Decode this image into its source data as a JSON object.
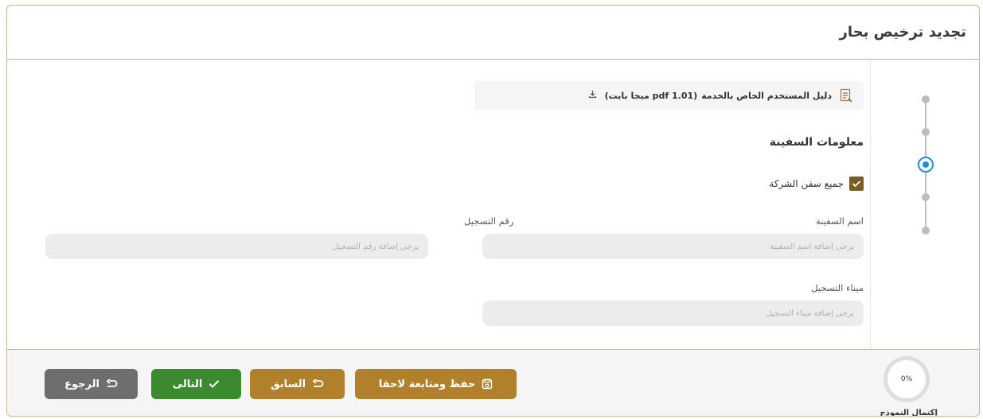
{
  "header": {
    "title": "تجديد ترخيص بحار"
  },
  "guide": {
    "text": "دليل المستخدم الخاص بالخدمة",
    "size": "(pdf 1.01 ميجا بايت)"
  },
  "section": {
    "title": "معلومات السفينة"
  },
  "checkbox": {
    "label": "جميع سفن الشركة",
    "checked": true
  },
  "fields": {
    "vessel_name": {
      "label": "اسم السفينة",
      "placeholder": "يرجى إضافة اسم السفينة"
    },
    "registration_number": {
      "label": "رقم التسجيل",
      "placeholder": "يرجى إضافة رقم التسجيل"
    },
    "registration_port": {
      "label": "ميناء التسجيل",
      "placeholder": "يرجى إضافة ميناء التسجيل"
    }
  },
  "progress": {
    "value": "0%",
    "label": "إكتمال النموذج"
  },
  "stepper": {
    "total_steps": 5,
    "active_step": 3
  },
  "buttons": {
    "save_later": "حفظ ومتابعة لاحقا",
    "previous": "السابق",
    "next": "التالى",
    "back": "الرجوع"
  },
  "colors": {
    "brown": "#b0812a",
    "green": "#3b8a2f",
    "gray": "#6e6e6e",
    "accent_blue": "#1e90d6",
    "checkbox": "#7a5c28"
  }
}
